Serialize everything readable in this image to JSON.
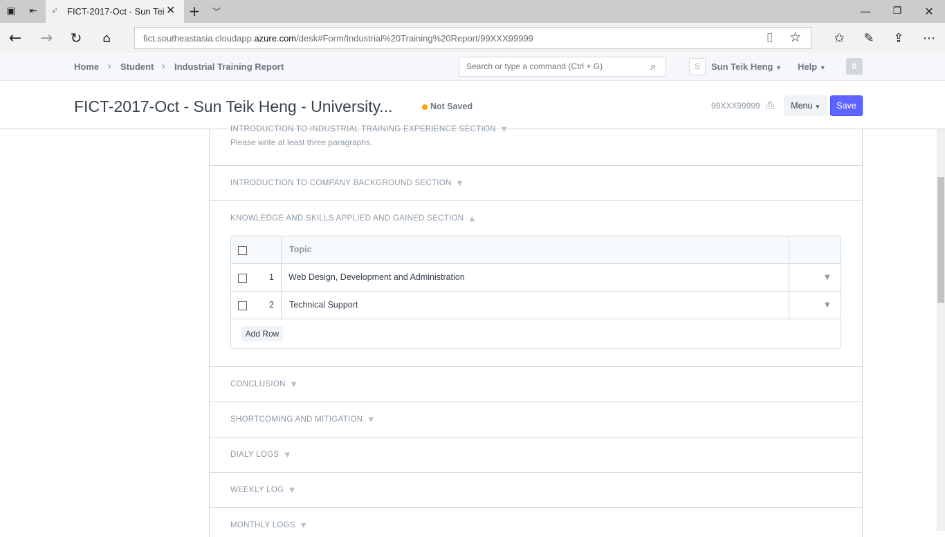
{
  "browser": {
    "tab_title": "FICT-2017-Oct - Sun Tei",
    "url_prefix": "fict.southeastasia.cloudapp.",
    "url_domain": "azure.com",
    "url_suffix": "/desk#Form/Industrial%20Training%20Report/99XXX99999"
  },
  "navbar": {
    "breadcrumbs": [
      "Home",
      "Student",
      "Industrial Training Report"
    ],
    "search_placeholder": "Search or type a command (Ctrl + G)",
    "avatar_letter": "S",
    "user_name": "Sun Teik Heng",
    "help_label": "Help",
    "notification_count": "0"
  },
  "pagehead": {
    "title": "FICT-2017-Oct - Sun Teik Heng - University...",
    "status": "Not Saved",
    "status_color": "#ff9f0e",
    "doc_id": "99XXX99999",
    "menu_label": "Menu",
    "save_label": "Save",
    "primary_color": "#5e64ff"
  },
  "sections": {
    "intro_industrial": "INTRODUCTION TO INDUSTRIAL TRAINING EXPERIENCE SECTION",
    "intro_help": "Please write at least three paragraphs.",
    "company_background": "INTRODUCTION TO COMPANY BACKGROUND SECTION",
    "knowledge_skills": "KNOWLEDGE AND SKILLS APPLIED AND GAINED SECTION",
    "conclusion": "CONCLUSION",
    "shortcoming": "SHORTCOMING AND MITIGATION",
    "daily_logs": "DIALY LOGS",
    "weekly_log": "WEEKLY LOG",
    "monthly_logs": "MONTHLY LOGS"
  },
  "grid": {
    "column_topic": "Topic",
    "rows": [
      {
        "idx": "1",
        "topic": "Web Design, Development and Administration"
      },
      {
        "idx": "2",
        "topic": "Technical Support"
      }
    ],
    "add_row_label": "Add Row"
  }
}
